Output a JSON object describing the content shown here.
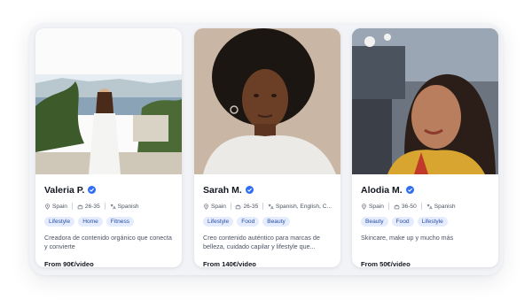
{
  "cards": [
    {
      "name": "Valeria P.",
      "country": "Spain",
      "age": "26-35",
      "languages": "Spanish",
      "tags": [
        "Lifestyle",
        "Home",
        "Fitness"
      ],
      "description": "Creadora de contenido orgánico que conecta y convierte",
      "price": "From 90€/video"
    },
    {
      "name": "Sarah M.",
      "country": "Spain",
      "age": "26-35",
      "languages": "Spanish, English, C...",
      "tags": [
        "Lifestyle",
        "Food",
        "Beauty"
      ],
      "description": "Creo contenido auténtico para marcas de belleza, cuidado capilar y lifestyle que...",
      "price": "From 140€/video"
    },
    {
      "name": "Alodia M.",
      "country": "Spain",
      "age": "36-50",
      "languages": "Spanish",
      "tags": [
        "Beauty",
        "Food",
        "Lifestyle"
      ],
      "description": "Skincare, make up y mucho más",
      "price": "From 50€/video"
    }
  ],
  "colors": {
    "accent": "#2f6df5",
    "tag_bg": "#e4ecfd",
    "tag_text": "#2a4fa8"
  },
  "icons": [
    "verified-badge-icon",
    "location-pin-icon",
    "age-group-icon",
    "language-icon"
  ]
}
